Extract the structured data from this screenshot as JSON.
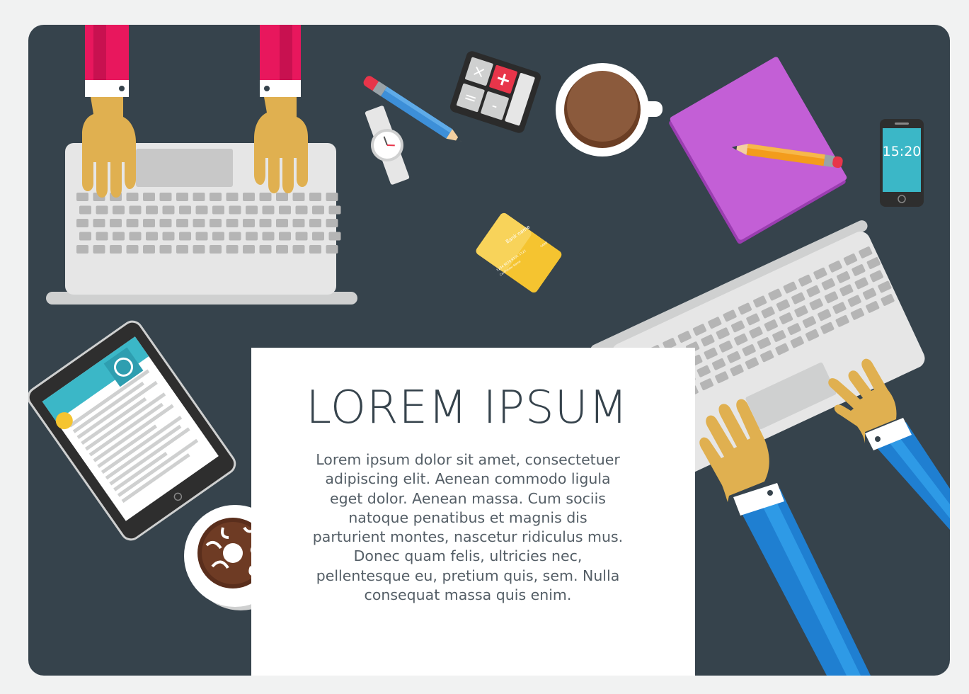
{
  "poster": {
    "title": "LOREM IPSUM",
    "body_lines": [
      "Lorem ipsum dolor sit amet, consectetuer",
      "adipiscing elit. Aenean commodo ligula",
      "eget dolor. Aenean massa. Cum sociis",
      "natoque penatibus et magnis dis",
      "parturient montes, nascetur ridiculus mus.",
      "Donec quam felis, ultricies nec,",
      "pellentesque eu, pretium quis, sem. Nulla",
      "consequat massa quis enim."
    ]
  },
  "phone": {
    "time": "15:20"
  },
  "credit_card": {
    "bank_name": "Bank name",
    "card_number": "1234 5678 9101 1121",
    "holder": "Cardholder Name",
    "brand": "CARD"
  },
  "colors": {
    "page_bg": "#f1f2f2",
    "desk": "#36434c",
    "paper": "#ffffff",
    "laptop": "#e6e6e6",
    "key": "#b3b3b3",
    "red_sleeve": "#e8175d",
    "blue_sleeve": "#1f7fd1",
    "skin": "#e0b050",
    "notebook": "#c35fd6",
    "card": "#f5c430",
    "coffee": "#8b5a3c"
  },
  "icons": [
    "laptop-icon",
    "hand-icon",
    "pencil-icon",
    "watch-icon",
    "calculator-icon",
    "coffee-cup-icon",
    "notebook-icon",
    "smartphone-icon",
    "credit-card-icon",
    "tablet-icon",
    "donut-icon"
  ]
}
